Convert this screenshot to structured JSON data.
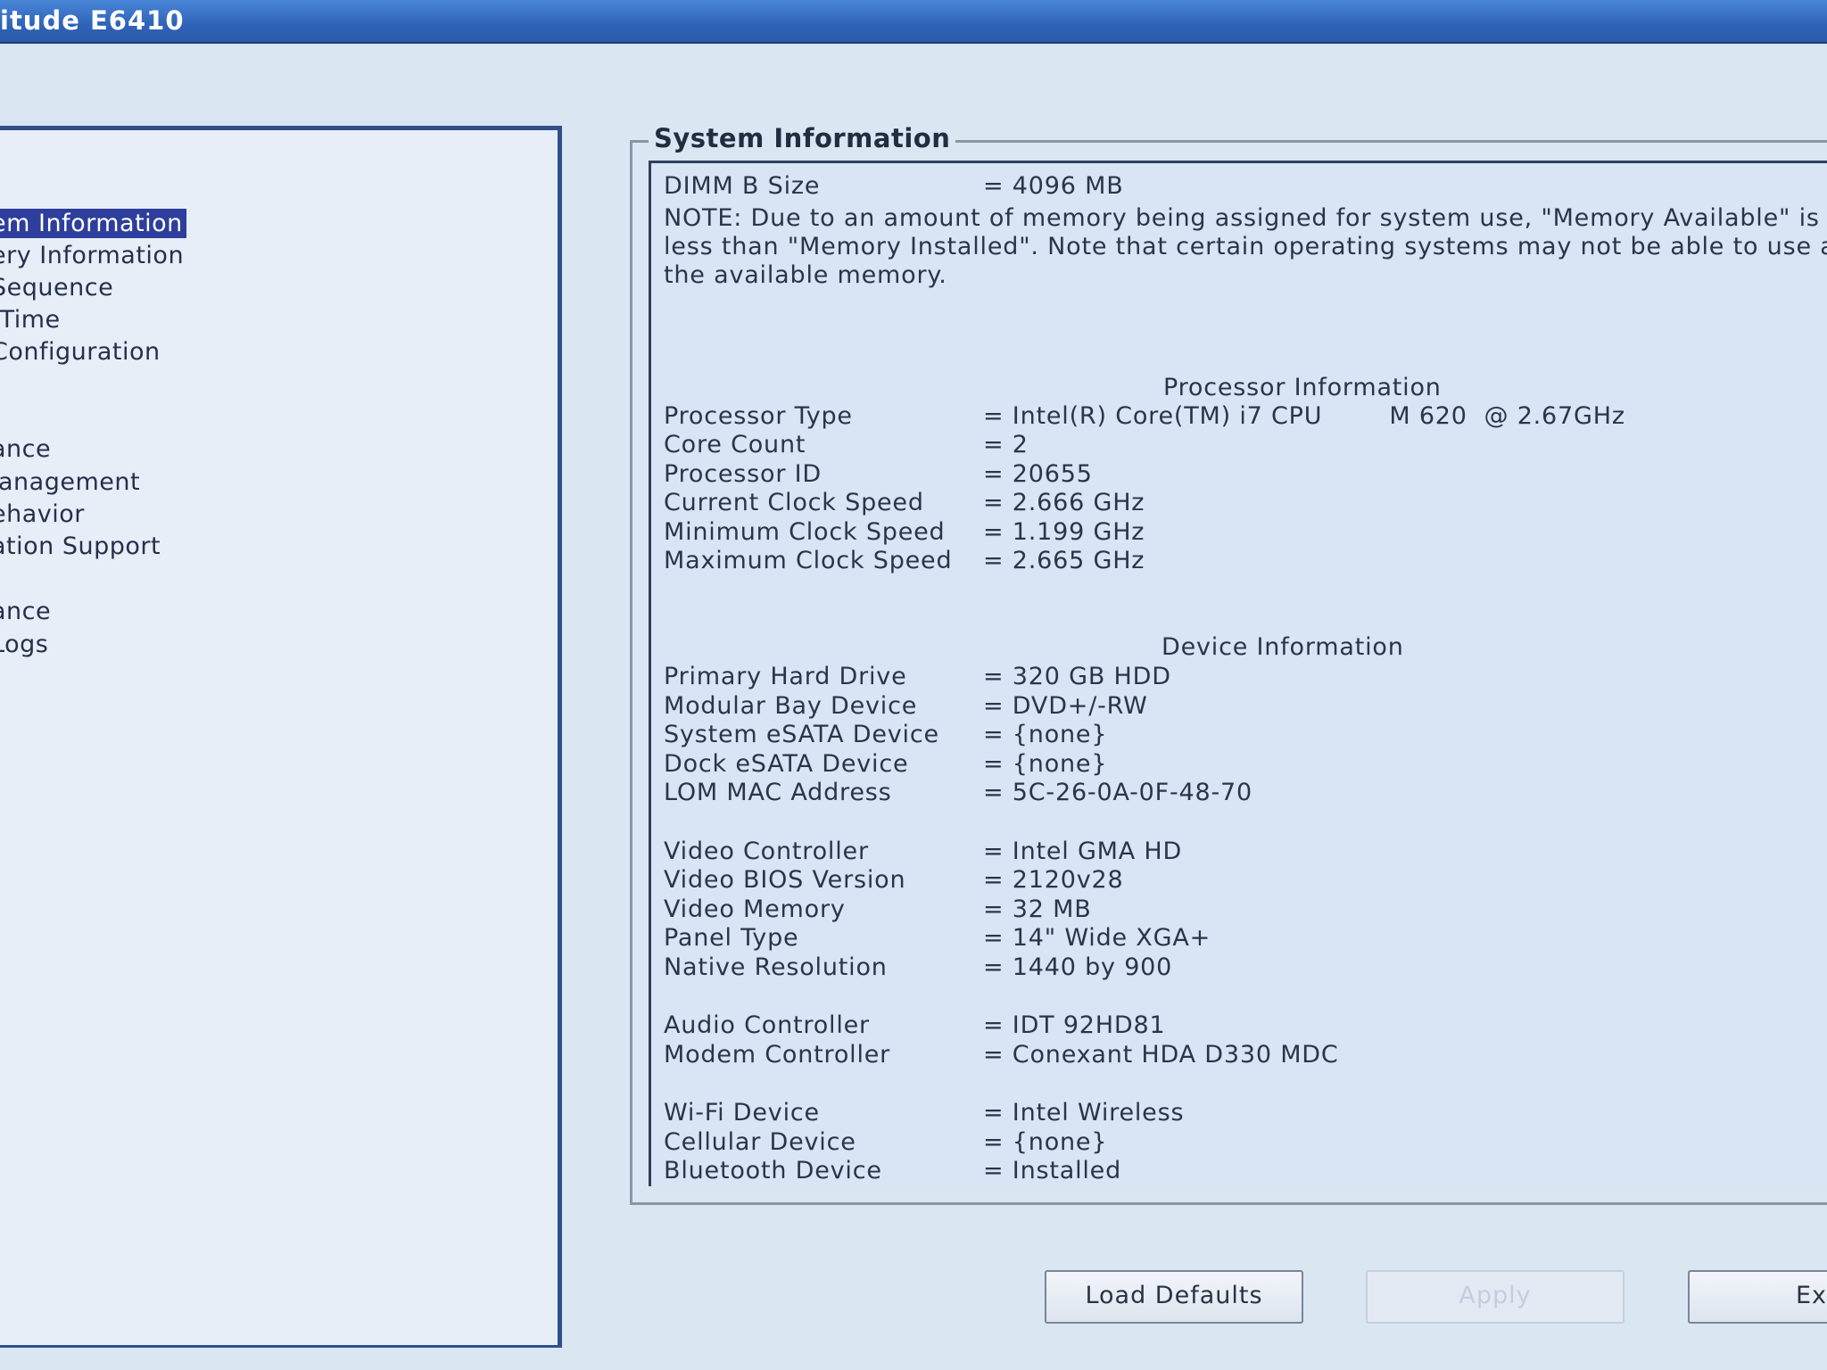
{
  "window": {
    "title": "itude E6410"
  },
  "nav": {
    "items": [
      {
        "label": "em Information",
        "selected": true
      },
      {
        "label": "ery Information"
      },
      {
        "label": " Sequence"
      },
      {
        "label": "/Time"
      },
      {
        "label": " Configuration"
      },
      {
        "label": "ance"
      },
      {
        "label": "lanagement"
      },
      {
        "label": "ehavior"
      },
      {
        "label": "ation Support"
      },
      {
        "label": "ance"
      },
      {
        "label": "Logs"
      }
    ]
  },
  "system_info": {
    "legend": "System Information",
    "dimm": {
      "label": "DIMM B Size",
      "value": "= 4096 MB"
    },
    "note": "NOTE: Due to an amount of memory being assigned for system use, \"Memory Available\" is less than \"Memory Installed\". Note that certain operating systems may not be able to use all the available memory.",
    "processor_heading": "Processor Information",
    "processor": [
      {
        "label": "Processor Type",
        "value": "= Intel(R) Core(TM) i7 CPU        M 620  @ 2.67GHz"
      },
      {
        "label": "Core Count",
        "value": "= 2"
      },
      {
        "label": "Processor ID",
        "value": "= 20655"
      },
      {
        "label": "Current Clock Speed",
        "value": "= 2.666 GHz"
      },
      {
        "label": "Minimum Clock Speed",
        "value": "= 1.199 GHz"
      },
      {
        "label": "Maximum Clock Speed",
        "value": "= 2.665 GHz"
      }
    ],
    "device_heading": "Device Information",
    "devices": [
      {
        "label": "Primary Hard Drive",
        "value": "= 320 GB HDD"
      },
      {
        "label": "Modular Bay Device",
        "value": "= DVD+/-RW"
      },
      {
        "label": "System eSATA Device",
        "value": "= {none}"
      },
      {
        "label": "Dock eSATA Device",
        "value": "= {none}"
      },
      {
        "label": "LOM MAC Address",
        "value": "= 5C-26-0A-0F-48-70"
      },
      {
        "label": "Video Controller",
        "value": "= Intel GMA HD"
      },
      {
        "label": "Video BIOS Version",
        "value": "= 2120v28"
      },
      {
        "label": "Video Memory",
        "value": "= 32 MB"
      },
      {
        "label": "Panel Type",
        "value": "= 14\" Wide XGA+"
      },
      {
        "label": "Native Resolution",
        "value": "= 1440 by 900"
      },
      {
        "label": "Audio Controller",
        "value": "= IDT 92HD81"
      },
      {
        "label": "Modem Controller",
        "value": "= Conexant HDA D330 MDC"
      },
      {
        "label": "Wi-Fi Device",
        "value": "= Intel Wireless"
      },
      {
        "label": "Cellular Device",
        "value": "= {none}"
      },
      {
        "label": "Bluetooth Device",
        "value": "= Installed"
      }
    ]
  },
  "buttons": {
    "load_defaults": "Load Defaults",
    "apply": "Apply",
    "exit": "Ex"
  }
}
